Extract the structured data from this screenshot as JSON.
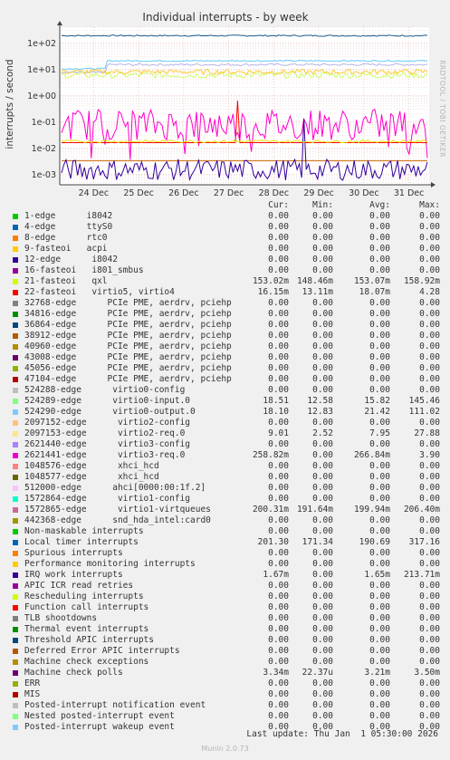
{
  "chart_data": {
    "type": "line",
    "title": "Individual interrupts - by week",
    "ylabel": "interrupts / second",
    "yscale": "log",
    "ylim": [
      0.0004,
      400
    ],
    "yticks": [
      "1e-03",
      "1e-02",
      "1e-01",
      "1e+00",
      "1e+01",
      "1e+02"
    ],
    "xticks": [
      "24 Dec",
      "25 Dec",
      "26 Dec",
      "27 Dec",
      "28 Dec",
      "29 Dec",
      "30 Dec",
      "31 Dec"
    ],
    "grid": true,
    "side_label": "RRDTOOL / TOBI OETIKER",
    "series": [
      {
        "name": "Local timer interrupts",
        "color": "#1a5a8c",
        "level": 190,
        "noise": 0.05
      },
      {
        "name": "virtio0-input.0",
        "color": "#b3b3e6",
        "level": 15,
        "noise": 0.08,
        "step": 2.0
      },
      {
        "name": "virtio0-output.0",
        "color": "#66ccff",
        "level": 21,
        "noise": 0.05,
        "step": 2.0
      },
      {
        "name": "virtio1-virtqueues",
        "color": "#ccff66",
        "level": 6,
        "noise": 0.25
      },
      {
        "name": "qxl",
        "color": "#ffcc33",
        "level": 8,
        "noise": 0.2
      },
      {
        "name": "virtio3-req.0",
        "color": "#ff00cc",
        "level": 0.08,
        "noise": 1.2,
        "dips": true
      },
      {
        "name": "Function call interrupts",
        "color": "#ff0000",
        "level": 0.016,
        "noise": 0.0,
        "spike": true
      },
      {
        "name": "Machine check polls",
        "color": "#cc6600",
        "level": 0.0033,
        "noise": 0.0
      },
      {
        "name": "IRQ work interrupts",
        "color": "#330099",
        "level": 0.0015,
        "noise": 0.8,
        "spike": true
      },
      {
        "name": "virtio5, virtio4",
        "color": "#e6e600",
        "level": 0.018,
        "noise": 0.1
      }
    ]
  },
  "legend": {
    "headers": [
      "Cur:",
      "Min:",
      "Avg:",
      "Max:"
    ],
    "rows": [
      {
        "label": "1-edge      i8042",
        "color": "#00cc00",
        "cur": "0.00",
        "min": "0.00",
        "avg": "0.00",
        "max": "0.00"
      },
      {
        "label": "4-edge      ttyS0",
        "color": "#0066b3",
        "cur": "0.00",
        "min": "0.00",
        "avg": "0.00",
        "max": "0.00"
      },
      {
        "label": "8-edge      rtc0",
        "color": "#ff8000",
        "cur": "0.00",
        "min": "0.00",
        "avg": "0.00",
        "max": "0.00"
      },
      {
        "label": "9-fasteoi   acpi",
        "color": "#ffcc00",
        "cur": "0.00",
        "min": "0.00",
        "avg": "0.00",
        "max": "0.00"
      },
      {
        "label": "12-edge      i8042",
        "color": "#330099",
        "cur": "0.00",
        "min": "0.00",
        "avg": "0.00",
        "max": "0.00"
      },
      {
        "label": "16-fasteoi   i801_smbus",
        "color": "#990099",
        "cur": "0.00",
        "min": "0.00",
        "avg": "0.00",
        "max": "0.00"
      },
      {
        "label": "21-fasteoi   qxl",
        "color": "#ccff00",
        "cur": "153.02m",
        "min": "148.46m",
        "avg": "153.07m",
        "max": "158.92m"
      },
      {
        "label": "22-fasteoi   virtio5, virtio4",
        "color": "#ff0000",
        "cur": "16.15m",
        "min": "13.11m",
        "avg": "18.07m",
        "max": "4.28"
      },
      {
        "label": "32768-edge      PCIe PME, aerdrv, pciehp",
        "color": "#808080",
        "cur": "0.00",
        "min": "0.00",
        "avg": "0.00",
        "max": "0.00"
      },
      {
        "label": "34816-edge      PCIe PME, aerdrv, pciehp",
        "color": "#008f00",
        "cur": "0.00",
        "min": "0.00",
        "avg": "0.00",
        "max": "0.00"
      },
      {
        "label": "36864-edge      PCIe PME, aerdrv, pciehp",
        "color": "#00487d",
        "cur": "0.00",
        "min": "0.00",
        "avg": "0.00",
        "max": "0.00"
      },
      {
        "label": "38912-edge      PCIe PME, aerdrv, pciehp",
        "color": "#b35a00",
        "cur": "0.00",
        "min": "0.00",
        "avg": "0.00",
        "max": "0.00"
      },
      {
        "label": "40960-edge      PCIe PME, aerdrv, pciehp",
        "color": "#b38f00",
        "cur": "0.00",
        "min": "0.00",
        "avg": "0.00",
        "max": "0.00"
      },
      {
        "label": "43008-edge      PCIe PME, aerdrv, pciehp",
        "color": "#6b006b",
        "cur": "0.00",
        "min": "0.00",
        "avg": "0.00",
        "max": "0.00"
      },
      {
        "label": "45056-edge      PCIe PME, aerdrv, pciehp",
        "color": "#8fb300",
        "cur": "0.00",
        "min": "0.00",
        "avg": "0.00",
        "max": "0.00"
      },
      {
        "label": "47104-edge      PCIe PME, aerdrv, pciehp",
        "color": "#b30000",
        "cur": "0.00",
        "min": "0.00",
        "avg": "0.00",
        "max": "0.00"
      },
      {
        "label": "524288-edge      virtio0-config",
        "color": "#bebebe",
        "cur": "0.00",
        "min": "0.00",
        "avg": "0.00",
        "max": "0.00"
      },
      {
        "label": "524289-edge      virtio0-input.0",
        "color": "#80ff80",
        "cur": "18.51",
        "min": "12.58",
        "avg": "15.82",
        "max": "145.46"
      },
      {
        "label": "524290-edge      virtio0-output.0",
        "color": "#80c9ff",
        "cur": "18.10",
        "min": "12.83",
        "avg": "21.42",
        "max": "111.02"
      },
      {
        "label": "2097152-edge      virtio2-config",
        "color": "#ffc080",
        "cur": "0.00",
        "min": "0.00",
        "avg": "0.00",
        "max": "0.00"
      },
      {
        "label": "2097153-edge      virtio2-req.0",
        "color": "#ffe680",
        "cur": "9.01",
        "min": "2.52",
        "avg": "7.95",
        "max": "27.88"
      },
      {
        "label": "2621440-edge      virtio3-config",
        "color": "#aa80ff",
        "cur": "0.00",
        "min": "0.00",
        "avg": "0.00",
        "max": "0.00"
      },
      {
        "label": "2621441-edge      virtio3-req.0",
        "color": "#ee00cc",
        "cur": "258.82m",
        "min": "0.00",
        "avg": "266.84m",
        "max": "3.90"
      },
      {
        "label": "1048576-edge      xhci_hcd",
        "color": "#ff8080",
        "cur": "0.00",
        "min": "0.00",
        "avg": "0.00",
        "max": "0.00"
      },
      {
        "label": "1048577-edge      xhci_hcd",
        "color": "#666600",
        "cur": "0.00",
        "min": "0.00",
        "avg": "0.00",
        "max": "0.00"
      },
      {
        "label": "512000-edge      ahci[0000:00:1f.2]",
        "color": "#ffbfff",
        "cur": "0.00",
        "min": "0.00",
        "avg": "0.00",
        "max": "0.00"
      },
      {
        "label": "1572864-edge      virtio1-config",
        "color": "#00ffcc",
        "cur": "0.00",
        "min": "0.00",
        "avg": "0.00",
        "max": "0.00"
      },
      {
        "label": "1572865-edge      virtio1-virtqueues",
        "color": "#cc6699",
        "cur": "200.31m",
        "min": "191.64m",
        "avg": "199.94m",
        "max": "206.40m"
      },
      {
        "label": "442368-edge      snd_hda_intel:card0",
        "color": "#999900",
        "cur": "0.00",
        "min": "0.00",
        "avg": "0.00",
        "max": "0.00"
      },
      {
        "label": "Non-maskable interrupts",
        "color": "#00cc00",
        "cur": "0.00",
        "min": "0.00",
        "avg": "0.00",
        "max": "0.00"
      },
      {
        "label": "Local timer interrupts",
        "color": "#0066b3",
        "cur": "201.30",
        "min": "171.34",
        "avg": "190.69",
        "max": "317.16"
      },
      {
        "label": "Spurious interrupts",
        "color": "#ff8000",
        "cur": "0.00",
        "min": "0.00",
        "avg": "0.00",
        "max": "0.00"
      },
      {
        "label": "Performance monitoring interrupts",
        "color": "#ffcc00",
        "cur": "0.00",
        "min": "0.00",
        "avg": "0.00",
        "max": "0.00"
      },
      {
        "label": "IRQ work interrupts",
        "color": "#330099",
        "cur": "1.67m",
        "min": "0.00",
        "avg": "1.65m",
        "max": "213.71m"
      },
      {
        "label": "APIC ICR read retries",
        "color": "#990099",
        "cur": "0.00",
        "min": "0.00",
        "avg": "0.00",
        "max": "0.00"
      },
      {
        "label": "Rescheduling interrupts",
        "color": "#ccff00",
        "cur": "0.00",
        "min": "0.00",
        "avg": "0.00",
        "max": "0.00"
      },
      {
        "label": "Function call interrupts",
        "color": "#ff0000",
        "cur": "0.00",
        "min": "0.00",
        "avg": "0.00",
        "max": "0.00"
      },
      {
        "label": "TLB shootdowns",
        "color": "#808080",
        "cur": "0.00",
        "min": "0.00",
        "avg": "0.00",
        "max": "0.00"
      },
      {
        "label": "Thermal event interrupts",
        "color": "#008f00",
        "cur": "0.00",
        "min": "0.00",
        "avg": "0.00",
        "max": "0.00"
      },
      {
        "label": "Threshold APIC interrupts",
        "color": "#00487d",
        "cur": "0.00",
        "min": "0.00",
        "avg": "0.00",
        "max": "0.00"
      },
      {
        "label": "Deferred Error APIC interrupts",
        "color": "#b35a00",
        "cur": "0.00",
        "min": "0.00",
        "avg": "0.00",
        "max": "0.00"
      },
      {
        "label": "Machine check exceptions",
        "color": "#b38f00",
        "cur": "0.00",
        "min": "0.00",
        "avg": "0.00",
        "max": "0.00"
      },
      {
        "label": "Machine check polls",
        "color": "#6b006b",
        "cur": "3.34m",
        "min": "22.37u",
        "avg": "3.21m",
        "max": "3.50m"
      },
      {
        "label": "ERR",
        "color": "#8fb300",
        "cur": "0.00",
        "min": "0.00",
        "avg": "0.00",
        "max": "0.00"
      },
      {
        "label": "MIS",
        "color": "#b30000",
        "cur": "0.00",
        "min": "0.00",
        "avg": "0.00",
        "max": "0.00"
      },
      {
        "label": "Posted-interrupt notification event",
        "color": "#bebebe",
        "cur": "0.00",
        "min": "0.00",
        "avg": "0.00",
        "max": "0.00"
      },
      {
        "label": "Nested posted-interrupt event",
        "color": "#80ff80",
        "cur": "0.00",
        "min": "0.00",
        "avg": "0.00",
        "max": "0.00"
      },
      {
        "label": "Posted-interrupt wakeup event",
        "color": "#80c9ff",
        "cur": "0.00",
        "min": "0.00",
        "avg": "0.00",
        "max": "0.00"
      }
    ]
  },
  "footer": {
    "last_update": "Last update: Thu Jan  1 05:30:00 2026",
    "version": "Munin 2.0.73"
  }
}
